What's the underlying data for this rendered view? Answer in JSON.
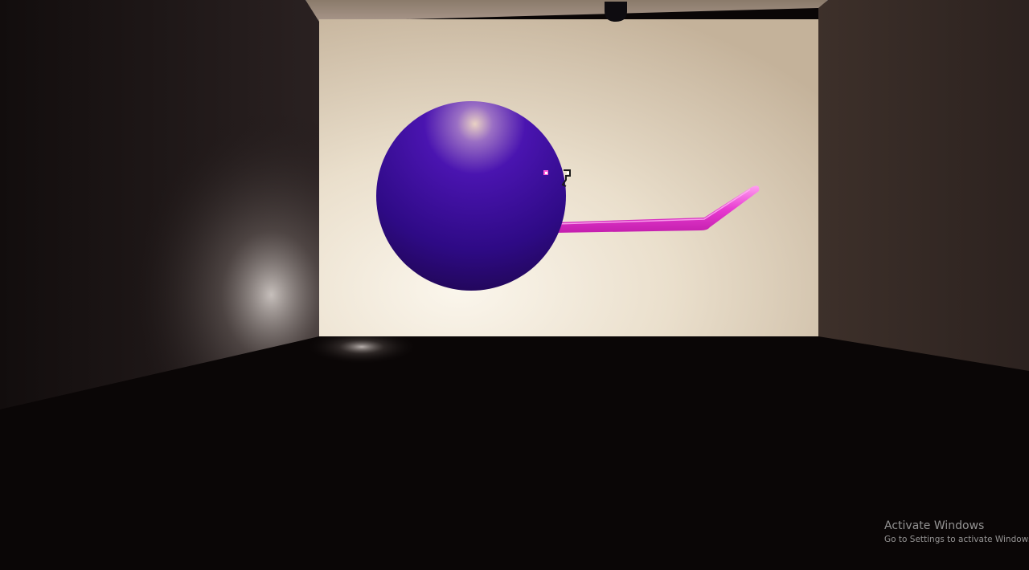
{
  "watermark": {
    "title": "Activate Windows",
    "subtitle": "Go to Settings to activate Windows."
  },
  "colors": {
    "back_wall": "#f2e8d8",
    "back_wall_shade": "#c9b79f",
    "left_wall": "#1a1313",
    "right_wall": "#3a2c27",
    "ceiling": "#9e8c79",
    "floor": "#0a0606",
    "sphere": "#3e0b98",
    "sphere_dark": "#1f0650",
    "sphere_highlight": "#e9d2c2",
    "tail": "#e83bd1",
    "tail_highlight": "#ff9ff0",
    "ceiling_fixture": "#0e0c10",
    "window_border": "#2f6fd0"
  },
  "scene": {
    "objects": [
      {
        "name": "back-wall"
      },
      {
        "name": "left-wall"
      },
      {
        "name": "right-wall"
      },
      {
        "name": "ceiling"
      },
      {
        "name": "floor"
      },
      {
        "name": "ceiling-fixture"
      },
      {
        "name": "purple-sphere"
      },
      {
        "name": "pink-tail"
      },
      {
        "name": "sphere-eye"
      }
    ]
  }
}
